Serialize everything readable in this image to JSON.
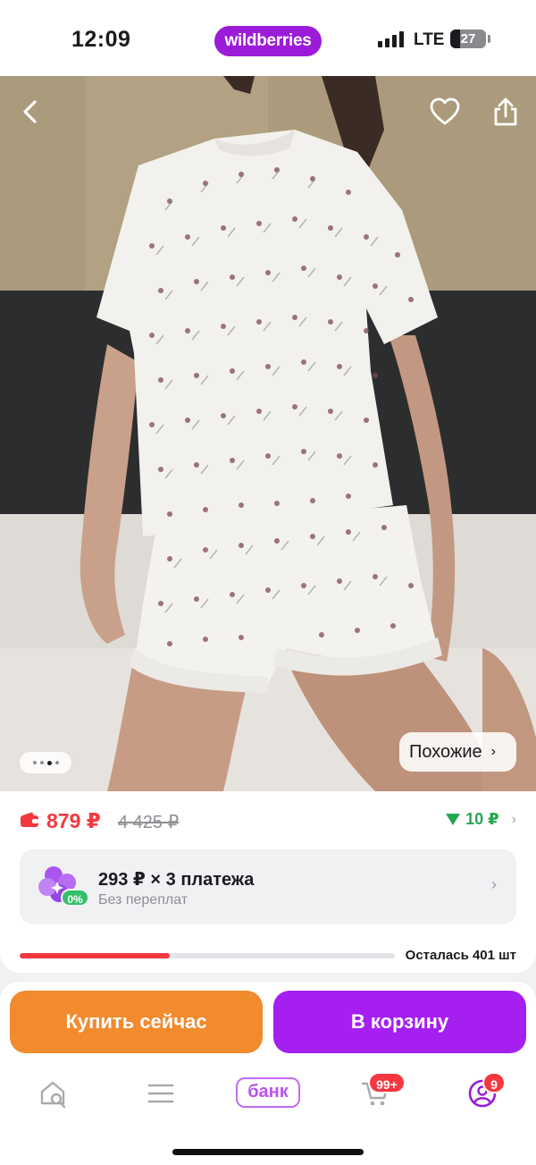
{
  "status_bar": {
    "time": "12:09",
    "brand": "wildberries",
    "network": "LTE",
    "battery_level": "27"
  },
  "product": {
    "gallery": {
      "image_count": 4,
      "active_index": 2,
      "similar_label": "Похожие"
    },
    "price": "879 ₽",
    "old_price": "4 425 ₽",
    "cashback": "10 ₽",
    "installments": {
      "title": "293 ₽ × 3 платежа",
      "subtitle": "Без переплат",
      "badge": "0%"
    },
    "stock": {
      "label": "Осталась 401 шт",
      "progress_fraction": 0.4
    }
  },
  "actions": {
    "buy_now": "Купить сейчас",
    "add_to_cart": "В корзину"
  },
  "bottom_nav": {
    "items": [
      {
        "name": "home-search-icon"
      },
      {
        "name": "menu-icon"
      },
      {
        "name": "bank",
        "label": "банк"
      },
      {
        "name": "cart-icon",
        "badge": "99+"
      },
      {
        "name": "profile-icon",
        "badge": "9"
      }
    ]
  },
  "colors": {
    "brand": "#9b1bd8",
    "price_red": "#f5383f",
    "cashback_green": "#22a852",
    "buy_orange": "#f28a2e",
    "cart_purple": "#a51ff0"
  }
}
